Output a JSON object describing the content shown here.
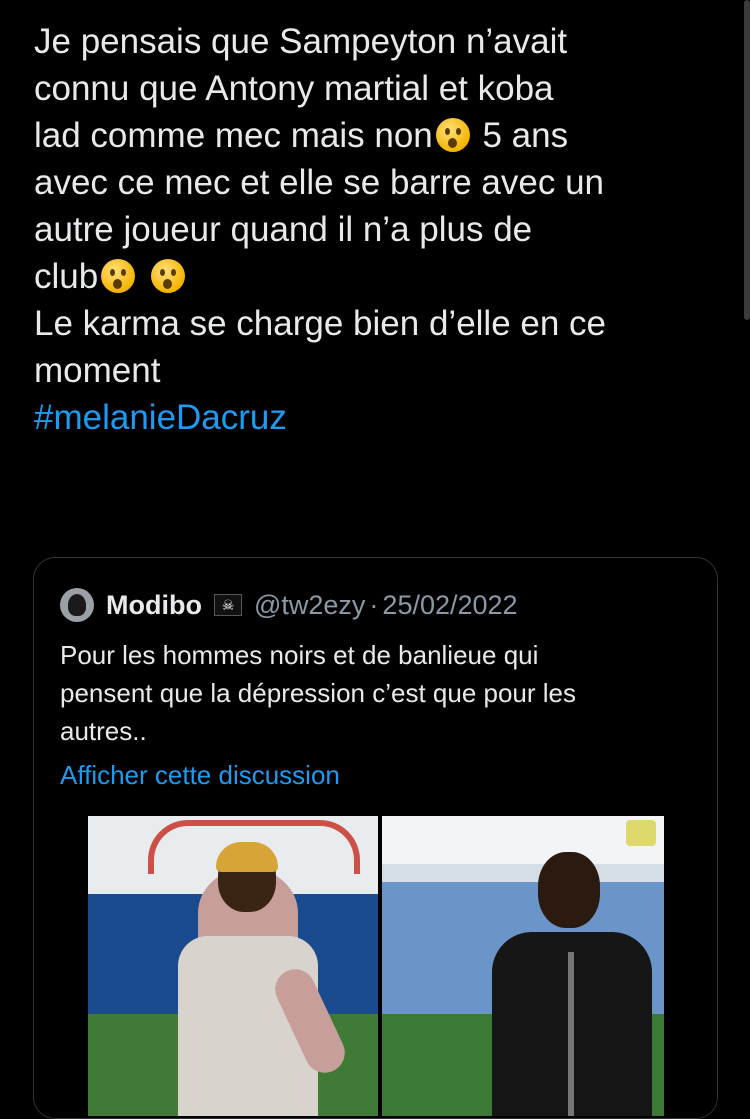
{
  "tweet": {
    "lines": [
      "Je pensais que Sampeyton n’avait",
      "connu que Antony martial et koba",
      "lad comme mec mais non",
      " 5 ans",
      "avec ce mec et elle se barre avec un",
      "autre joueur quand il n’a plus de",
      "club",
      "Le karma se charge bien d’elle en ce",
      "moment"
    ],
    "hashtag": "#melanieDacruz",
    "emoji": "hushed-face"
  },
  "quoted_tweet": {
    "name": "Modibo",
    "badge_icon": "pirate-flag-icon",
    "handle": "@tw2ezy",
    "separator": "·",
    "date": "25/02/2022",
    "text_lines": [
      "Pour les hommes noirs et de banlieue qui",
      "pensent que la dépression c’est que pour les",
      "autres.."
    ],
    "show_thread_label": "Afficher cette discussion"
  },
  "colors": {
    "background": "#000000",
    "text": "#e7e9ea",
    "link": "#1d9bf0",
    "muted": "#8b98a5",
    "border": "#2f3336"
  }
}
